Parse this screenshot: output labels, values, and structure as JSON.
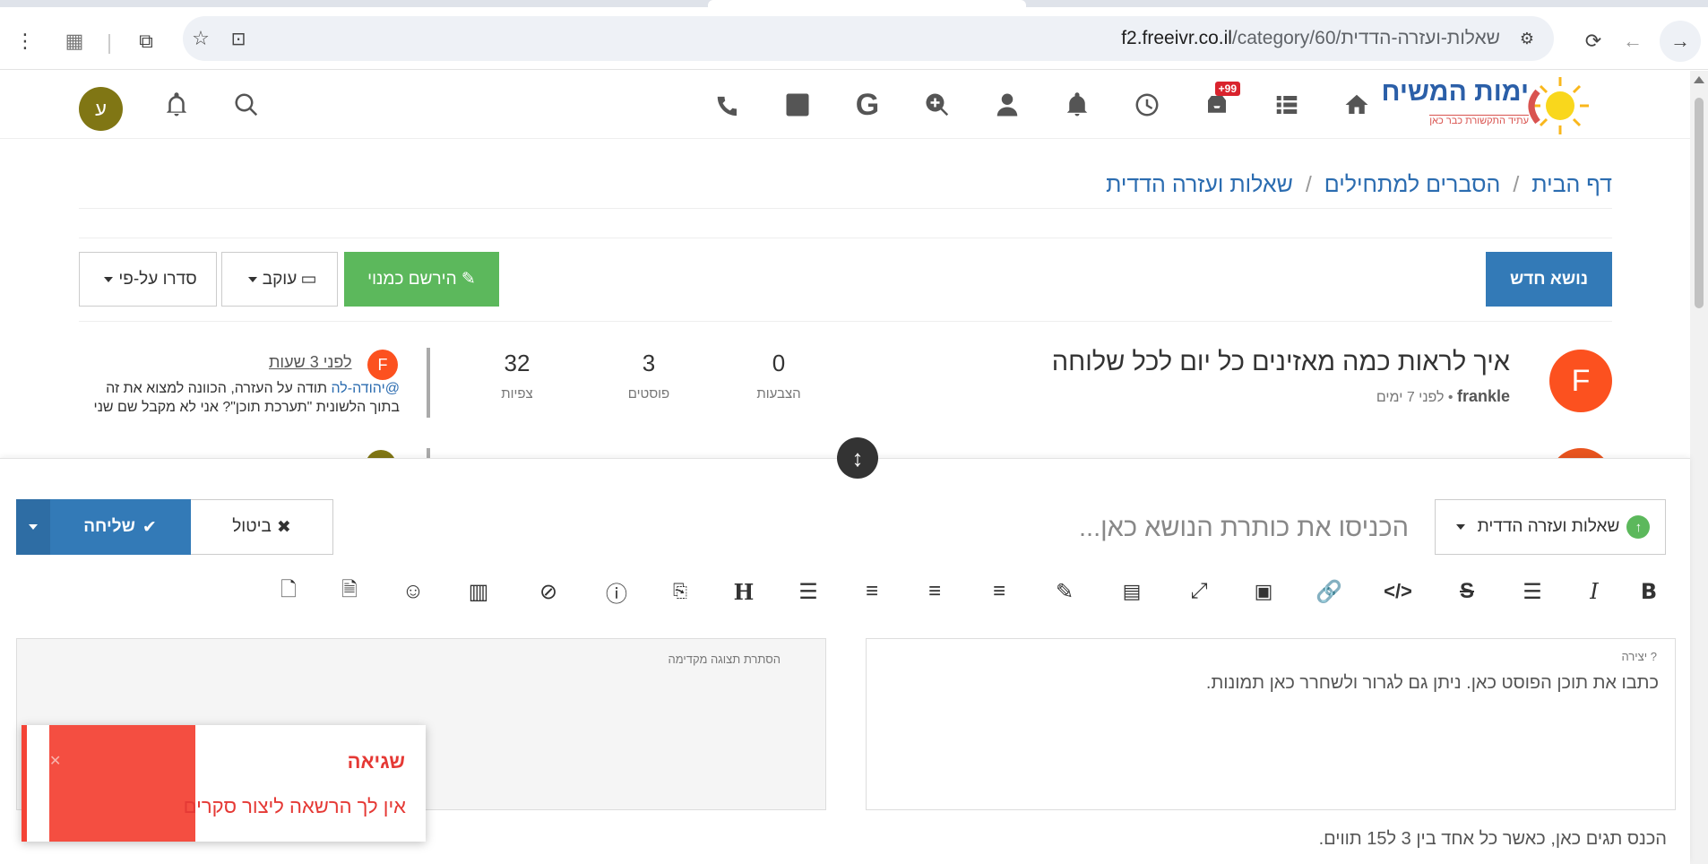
{
  "browser": {
    "url_host": "f2.freeivr.co.il",
    "url_path": "/category/60/שאלות-ועזרה-הדדית"
  },
  "nav": {
    "notifications_badge": "+99",
    "user_initial": "ע"
  },
  "logo": {
    "title": "ימות המשיח",
    "tagline": "עתיד התקשורת כבר כאן"
  },
  "breadcrumb": {
    "items": [
      "דף הבית",
      "הסברים למתחילים",
      "שאלות ועזרה הדדית"
    ]
  },
  "actions": {
    "new_topic": "נושא חדש",
    "follow": "הירשם כמנוי",
    "watch": "עוקב",
    "sort": "סדרו על-פי"
  },
  "topic": {
    "avatar_letter": "F",
    "title": "איך לראות כמה מאזינים כל יום לכל שלוחה",
    "author": "frankle",
    "time": "לפני 7 ימים",
    "stats": [
      {
        "value": "0",
        "label": "הצבעות"
      },
      {
        "value": "3",
        "label": "פוסטים"
      },
      {
        "value": "32",
        "label": "צפיות"
      }
    ],
    "teaser": {
      "avatar_letter": "F",
      "time": "לפני 3 שעות",
      "mention": "@יהודה-לה",
      "text": " תודה על העזרה, הכוונה למצוא את זה בתוך הלשונית \"תערכת תוכן\"? אני לא מקבל שם שני"
    }
  },
  "composer": {
    "category": "שאלות ועזרה הדדית",
    "title_placeholder": "הכניסו את כותרת הנושא כאן...",
    "cancel": "ביטול",
    "submit": "שליחה",
    "write_label": "יצירה",
    "write_placeholder": "כתבו את תוכן הפוסט כאן. ניתן גם לגרור ולשחרר כאן תמונות.",
    "preview_label": "הסתרת תצוגה מקדימה",
    "tags_hint": "הכנס תגים כאן, כאשר כל אחד בין 3 ל15 תווים."
  },
  "toast": {
    "title": "שגיאה",
    "message": "אין לך הרשאה ליצור סקרים"
  },
  "colors": {
    "primary": "#337ab7",
    "success": "#5cb85c",
    "danger": "#f44336",
    "avatar_orange": "#fc511f",
    "avatar_olive": "#807614"
  }
}
